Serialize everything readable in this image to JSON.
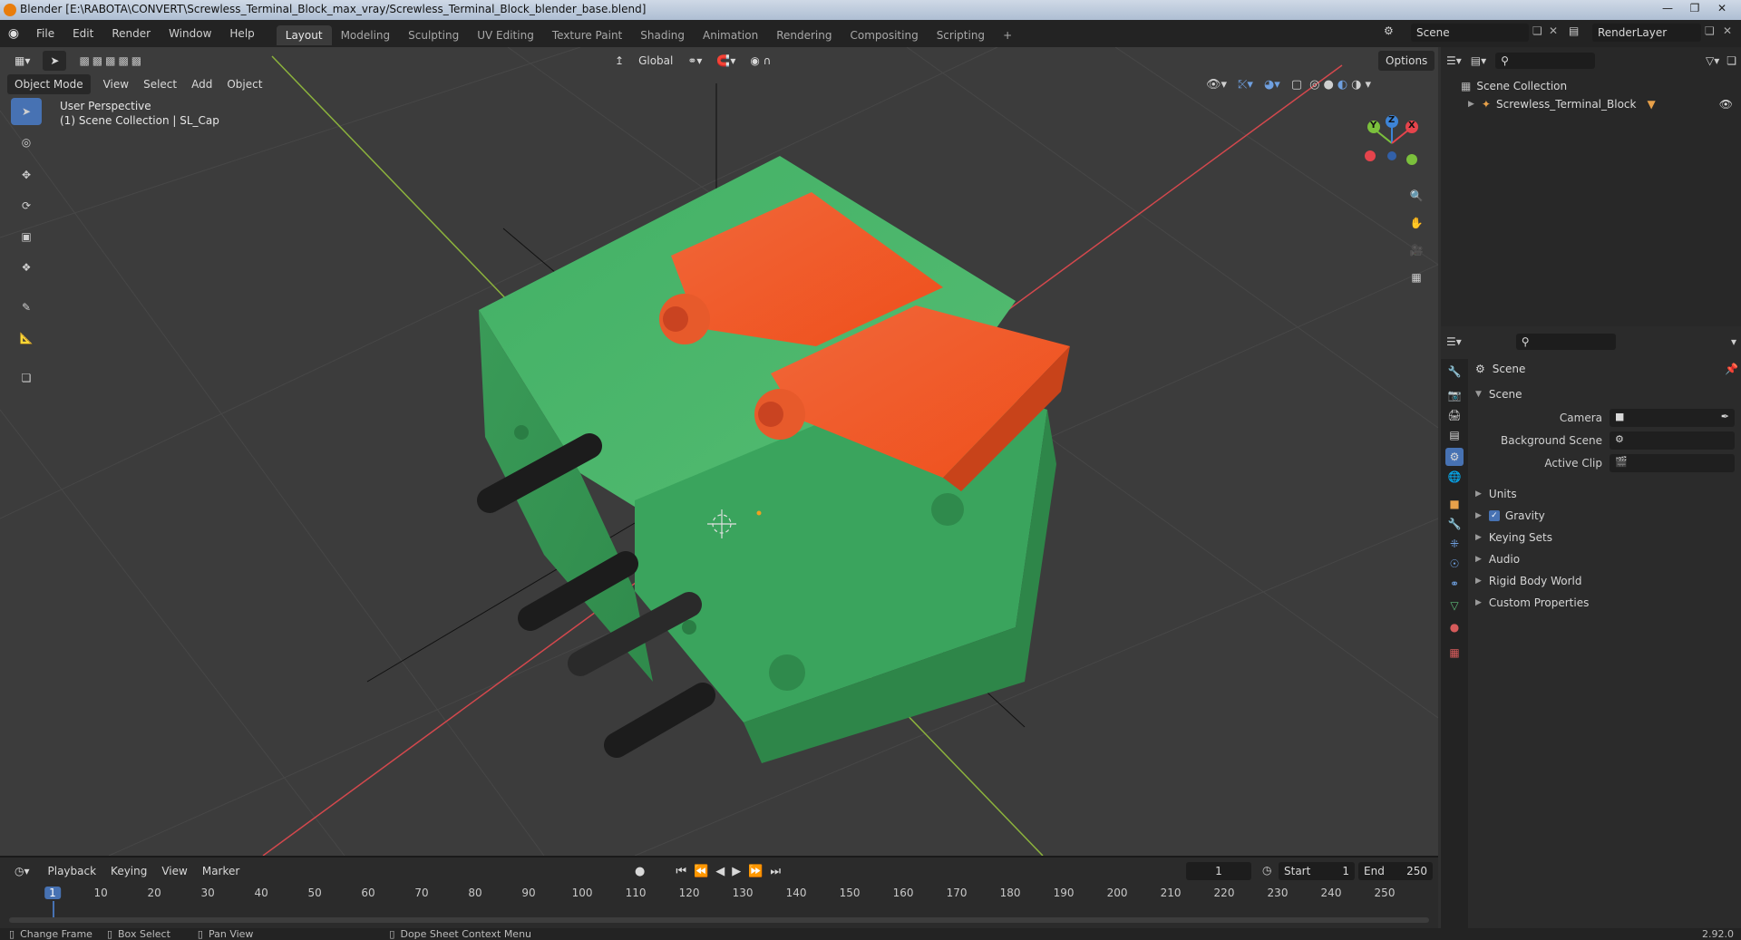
{
  "window": {
    "title": "Blender [E:\\RABOTA\\CONVERT\\Screwless_Terminal_Block_max_vray/Screwless_Terminal_Block_blender_base.blend]"
  },
  "menu": {
    "items": [
      "File",
      "Edit",
      "Render",
      "Window",
      "Help"
    ]
  },
  "workspaces": [
    {
      "label": "Layout",
      "active": true
    },
    {
      "label": "Modeling"
    },
    {
      "label": "Sculpting"
    },
    {
      "label": "UV Editing"
    },
    {
      "label": "Texture Paint"
    },
    {
      "label": "Shading"
    },
    {
      "label": "Animation"
    },
    {
      "label": "Rendering"
    },
    {
      "label": "Compositing"
    },
    {
      "label": "Scripting"
    },
    {
      "label": "+"
    }
  ],
  "scene_selector": {
    "value": "Scene"
  },
  "render_layer": {
    "value": "RenderLayer"
  },
  "viewport_header": {
    "transform_orientation": "Global",
    "options_label": "Options",
    "mode": "Object Mode",
    "menus": [
      "View",
      "Select",
      "Add",
      "Object"
    ]
  },
  "viewport_overlay": {
    "perspective": "User Perspective",
    "collection_info": "(1) Scene Collection | SL_Cap"
  },
  "gizmo": {
    "y": "Y",
    "z": "Z",
    "x": "X"
  },
  "tools": [
    {
      "icon": "select-box-icon",
      "active": true
    },
    {
      "icon": "cursor-icon"
    },
    {
      "icon": "move-icon"
    },
    {
      "icon": "rotate-icon"
    },
    {
      "icon": "scale-icon"
    },
    {
      "icon": "transform-icon"
    },
    {
      "icon": "annotate-icon"
    },
    {
      "icon": "measure-icon"
    },
    {
      "icon": "add-cube-icon"
    }
  ],
  "outliner": {
    "root": "Scene Collection",
    "child": "Screwless_Terminal_Block"
  },
  "properties": {
    "context": "Scene",
    "panel_title": "Scene",
    "fields": [
      {
        "label": "Camera",
        "value": ""
      },
      {
        "label": "Background Scene",
        "value": ""
      },
      {
        "label": "Active Clip",
        "value": ""
      }
    ],
    "subpanels": [
      {
        "label": "Units",
        "checkbox": false
      },
      {
        "label": "Gravity",
        "checkbox": true,
        "checked": true
      },
      {
        "label": "Keying Sets",
        "checkbox": false
      },
      {
        "label": "Audio",
        "checkbox": false
      },
      {
        "label": "Rigid Body World",
        "checkbox": false
      },
      {
        "label": "Custom Properties",
        "checkbox": false
      }
    ]
  },
  "timeline": {
    "menus": [
      "Playback",
      "Keying",
      "View",
      "Marker"
    ],
    "current_frame": "1",
    "start_label": "Start",
    "start_value": "1",
    "end_label": "End",
    "end_value": "250",
    "ruler": [
      "1",
      "10",
      "20",
      "30",
      "40",
      "50",
      "60",
      "70",
      "80",
      "90",
      "100",
      "110",
      "120",
      "130",
      "140",
      "150",
      "160",
      "170",
      "180",
      "190",
      "200",
      "210",
      "220",
      "230",
      "240",
      "250"
    ]
  },
  "statusbar": {
    "items": [
      "Change Frame",
      "Box Select",
      "Pan View",
      "Dope Sheet Context Menu"
    ],
    "version": "2.92.0"
  },
  "colors": {
    "accent": "#4772b3",
    "body_green": "#3fa65f",
    "cap_orange": "#f25a22",
    "pin_dark": "#1e1e1e",
    "axis_red": "#d3484d",
    "axis_green": "#8cb33c",
    "gizmo_x": "#e5444c",
    "gizmo_y": "#7bc03c",
    "gizmo_z": "#3d84d6"
  }
}
